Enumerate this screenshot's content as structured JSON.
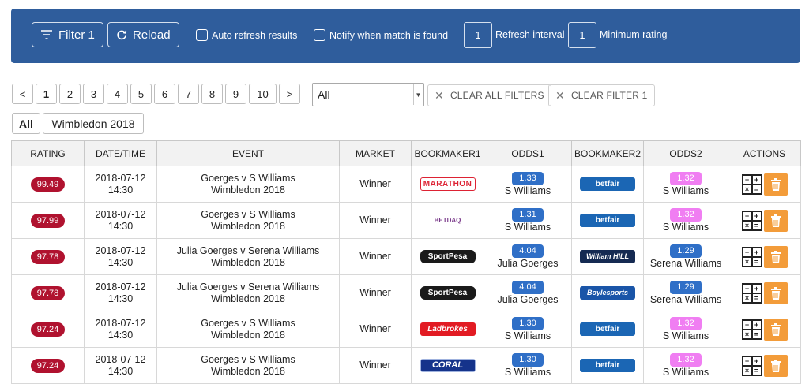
{
  "toolbar": {
    "filter_label": "Filter 1",
    "reload_label": "Reload",
    "auto_refresh_label": "Auto refresh results",
    "notify_label": "Notify when match is found",
    "refresh_interval_value": "1",
    "refresh_interval_label": "Refresh interval",
    "min_rating_value": "1",
    "min_rating_label": "Minimum rating"
  },
  "pagination": {
    "prev": "<",
    "pages": [
      "1",
      "2",
      "3",
      "4",
      "5",
      "6",
      "7",
      "8",
      "9",
      "10"
    ],
    "next": ">",
    "active_page": "1"
  },
  "filters": {
    "select_value": "All",
    "clear_all_label": "CLEAR ALL FILTERS",
    "clear_filter_label": "CLEAR FILTER 1"
  },
  "tags": [
    "All",
    "Wimbledon 2018"
  ],
  "table": {
    "headers": [
      "RATING",
      "DATE/TIME",
      "EVENT",
      "MARKET",
      "BOOKMAKER1",
      "ODDS1",
      "BOOKMAKER2",
      "ODDS2",
      "ACTIONS"
    ],
    "rows": [
      {
        "rating": "99.49",
        "date": "2018-07-12",
        "time": "14:30",
        "event": "Goerges v S Williams",
        "competition": "Wimbledon 2018",
        "market": "Winner",
        "bookmaker1": "MARATHON",
        "odds1": "1.33",
        "selection1": "S Williams",
        "bookmaker2": "betfair",
        "odds2": "1.32",
        "selection2": "S Williams"
      },
      {
        "rating": "97.99",
        "date": "2018-07-12",
        "time": "14:30",
        "event": "Goerges v S Williams",
        "competition": "Wimbledon 2018",
        "market": "Winner",
        "bookmaker1": "BETDAQ",
        "odds1": "1.31",
        "selection1": "S Williams",
        "bookmaker2": "betfair",
        "odds2": "1.32",
        "selection2": "S Williams"
      },
      {
        "rating": "97.78",
        "date": "2018-07-12",
        "time": "14:30",
        "event": "Julia Goerges v Serena Williams",
        "competition": "Wimbledon 2018",
        "market": "Winner",
        "bookmaker1": "SportPesa",
        "odds1": "4.04",
        "selection1": "Julia Goerges",
        "bookmaker2": "William HILL",
        "odds2": "1.29",
        "selection2": "Serena Williams"
      },
      {
        "rating": "97.78",
        "date": "2018-07-12",
        "time": "14:30",
        "event": "Julia Goerges v Serena Williams",
        "competition": "Wimbledon 2018",
        "market": "Winner",
        "bookmaker1": "SportPesa",
        "odds1": "4.04",
        "selection1": "Julia Goerges",
        "bookmaker2": "Boylesports",
        "odds2": "1.29",
        "selection2": "Serena Williams"
      },
      {
        "rating": "97.24",
        "date": "2018-07-12",
        "time": "14:30",
        "event": "Goerges v S Williams",
        "competition": "Wimbledon 2018",
        "market": "Winner",
        "bookmaker1": "Ladbrokes",
        "odds1": "1.30",
        "selection1": "S Williams",
        "bookmaker2": "betfair",
        "odds2": "1.32",
        "selection2": "S Williams"
      },
      {
        "rating": "97.24",
        "date": "2018-07-12",
        "time": "14:30",
        "event": "Goerges v S Williams",
        "competition": "Wimbledon 2018",
        "market": "Winner",
        "bookmaker1": "CORAL",
        "odds1": "1.30",
        "selection1": "S Williams",
        "bookmaker2": "betfair",
        "odds2": "1.32",
        "selection2": "S Williams"
      }
    ]
  },
  "colors": {
    "toolbar_bg": "#2f5d9c",
    "rating_badge": "#b0122f",
    "odds1_badge": "#2f6fc7",
    "odds2_badge": "#f07ef2",
    "delete_button": "#f39c3a"
  },
  "icons": {
    "filter": "filter-lines-icon",
    "reload": "refresh-icon",
    "clear": "x-icon",
    "calculator": "calculator-icon",
    "delete": "trash-icon"
  }
}
